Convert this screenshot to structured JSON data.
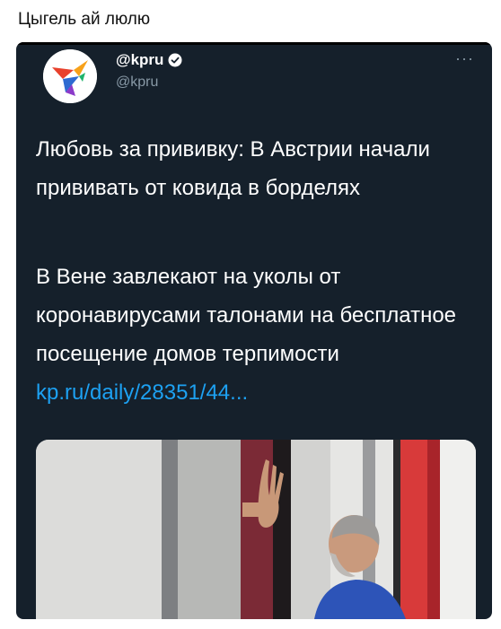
{
  "caption": "Цыгель ай люлю",
  "tweet": {
    "display_name": "@kpru",
    "handle": "@kpru",
    "paragraph1": "Любовь за прививку: В Австрии начали прививать от ковида в борделях",
    "paragraph2": "В Вене завлекают на уколы от коронавирусами талонами на бесплатное посещение домов терпимости",
    "link_text": "kp.ru/daily/28351/44...",
    "more_icon": "···"
  },
  "colors": {
    "card_bg": "#15202b",
    "text": "#ffffff",
    "handle": "#8899a6",
    "link": "#1da1f2",
    "verified": "#ffffff"
  },
  "icons": {
    "avatar": "kp-logo-bird",
    "verified": "verified-badge-icon",
    "more": "more-dots-icon"
  }
}
